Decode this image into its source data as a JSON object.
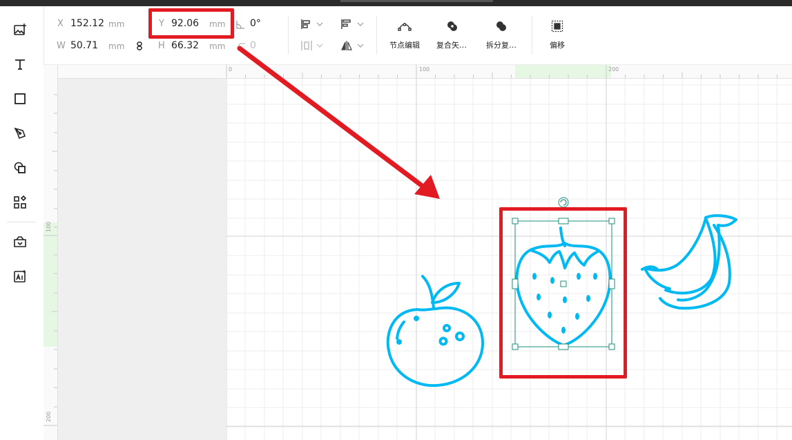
{
  "properties": {
    "x": {
      "label": "X",
      "value": "152.12",
      "unit": "mm"
    },
    "y": {
      "label": "Y",
      "value": "92.06",
      "unit": "mm"
    },
    "w": {
      "label": "W",
      "value": "50.71",
      "unit": "mm"
    },
    "h": {
      "label": "H",
      "value": "66.32",
      "unit": "mm"
    },
    "rotation": {
      "value": "0°"
    },
    "corner": {
      "value": "0"
    }
  },
  "toolbar_buttons": [
    {
      "label": "节点编辑",
      "icon": "node-edit-icon"
    },
    {
      "label": "复合矢…",
      "icon": "combine-vector-icon"
    },
    {
      "label": "拆分复…",
      "icon": "split-compound-icon"
    },
    {
      "label": "偏移",
      "icon": "offset-icon"
    }
  ],
  "rulers": {
    "top": [
      "0",
      "100",
      "200"
    ],
    "left": [
      "100",
      "200"
    ]
  },
  "tools": [
    "image-add-icon",
    "text-icon",
    "rectangle-icon",
    "pen-icon",
    "shapes-icon",
    "elements-icon",
    "material-icon",
    "ai-icon"
  ],
  "colors": {
    "accent": "#00b9f2",
    "highlight": "#e21b23",
    "selection": "#1a8f7e",
    "ruler_highlight": "#e6f8e3"
  },
  "canvas": {
    "objects": [
      "orange",
      "strawberry",
      "banana"
    ],
    "selected": "strawberry"
  }
}
